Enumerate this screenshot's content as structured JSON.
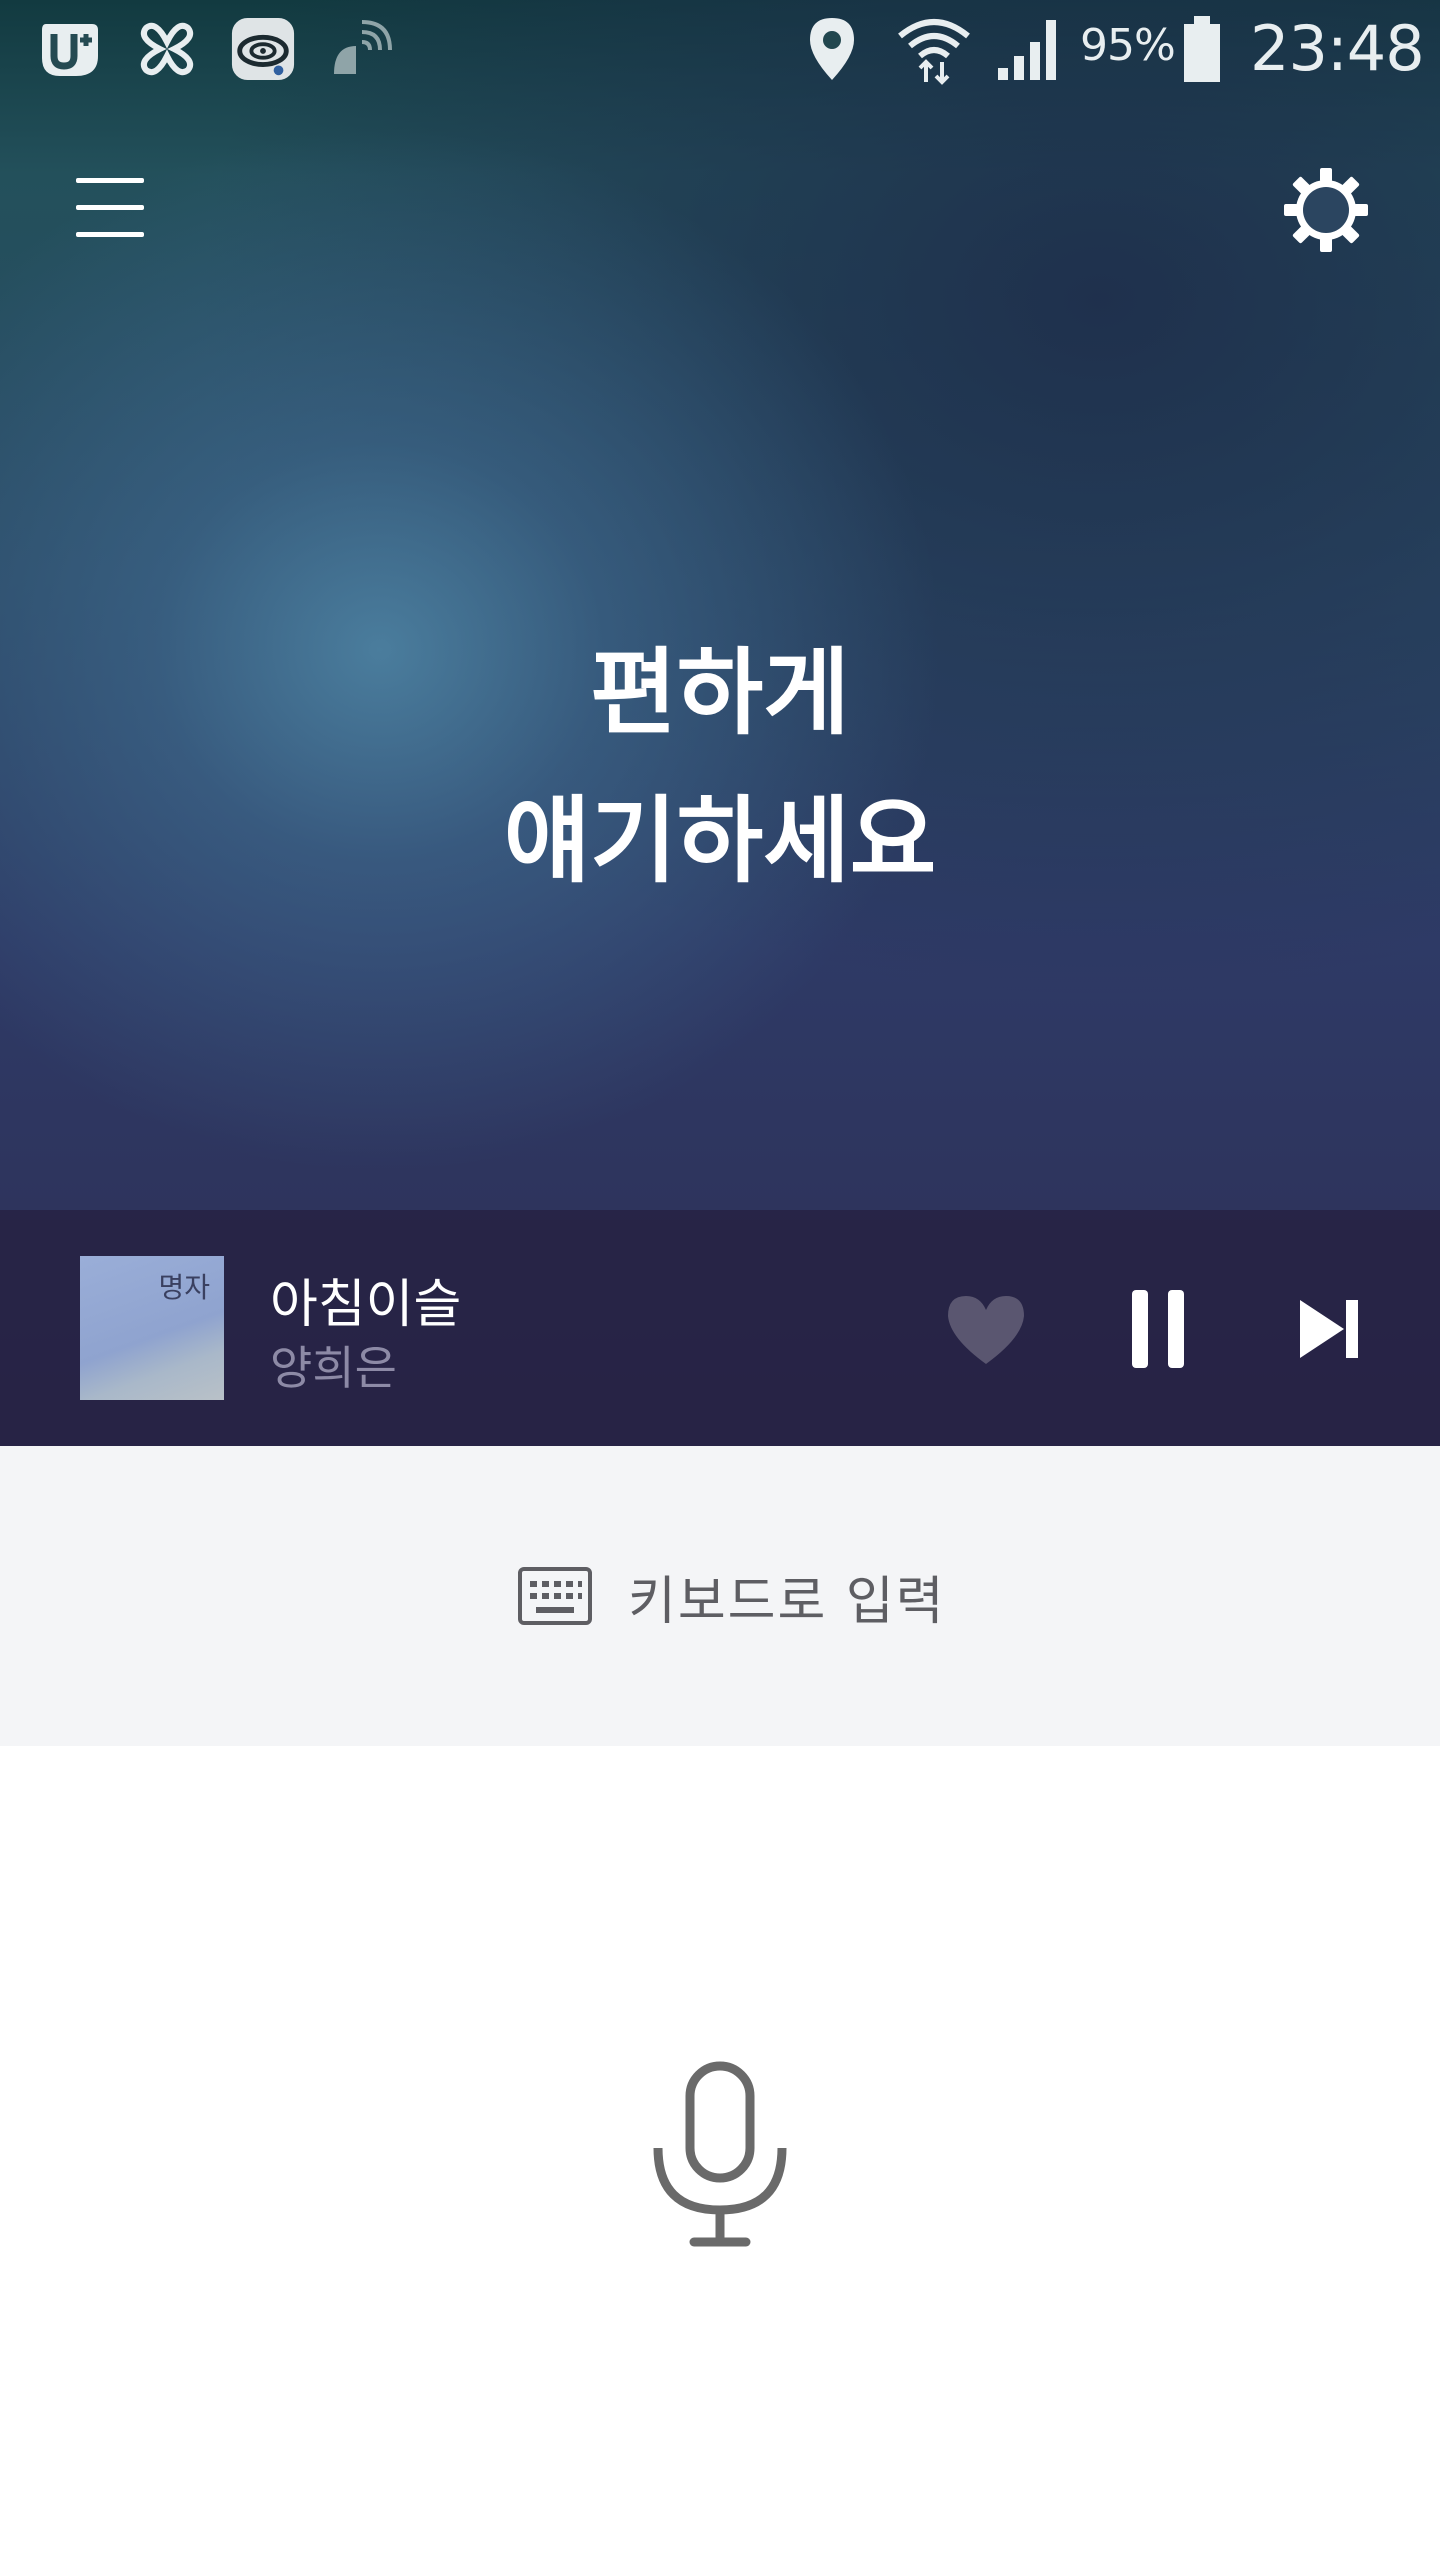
{
  "status_bar": {
    "battery_percent": "95%",
    "time": "23:48",
    "icons": [
      "u-plus-icon",
      "clover-icon",
      "app-disc-icon",
      "satellite-dish-icon",
      "location-pin-icon",
      "wifi-icon",
      "signal-bars-icon",
      "battery-icon"
    ]
  },
  "header": {
    "menu_icon": "hamburger-menu-icon",
    "settings_icon": "gear-icon"
  },
  "prompt": {
    "line1": "편하게",
    "line2": "얘기하세요"
  },
  "now_playing": {
    "title": "아침이슬",
    "artist": "양희은",
    "album_art_text": "명자",
    "liked": false,
    "state": "playing",
    "controls": [
      "heart-icon",
      "pause-icon",
      "skip-next-icon"
    ]
  },
  "keyboard_input": {
    "label": "키보드로 입력",
    "icon": "keyboard-icon"
  },
  "voice_input": {
    "icon": "microphone-icon"
  },
  "colors": {
    "accent_white": "#ffffff",
    "player_bg": "#262142",
    "artist_text": "#8d8aa6",
    "heart": "#5a5670",
    "panel_bg": "#f4f5f7",
    "icon_gray": "#6a6a6a"
  }
}
